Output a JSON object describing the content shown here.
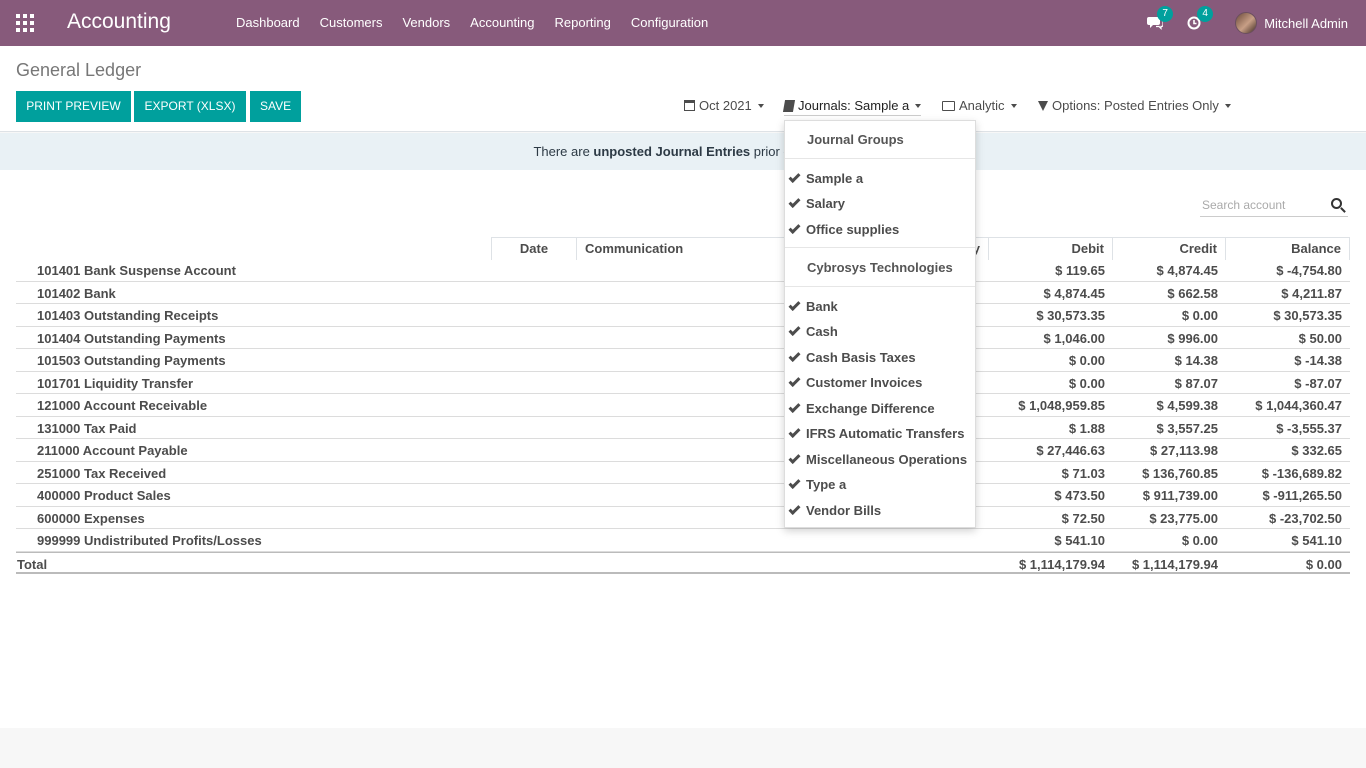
{
  "app": {
    "title": "Accounting"
  },
  "nav": {
    "menu": [
      "Dashboard",
      "Customers",
      "Vendors",
      "Accounting",
      "Reporting",
      "Configuration"
    ],
    "messages_count": "7",
    "activities_count": "4",
    "user": "Mitchell Admin"
  },
  "page": {
    "title": "General Ledger"
  },
  "buttons": {
    "print": "PRINT PREVIEW",
    "export": "EXPORT (XLSX)",
    "save": "SAVE"
  },
  "filters": {
    "period": "Oct 2021",
    "journals": "Journals: Sample a",
    "analytic": "Analytic",
    "options": "Options: Posted Entries Only"
  },
  "alert": {
    "prefix": "There are ",
    "strong": "unposted Journal Entries",
    "suffix": " prior or includ"
  },
  "search": {
    "placeholder": "Search account"
  },
  "table": {
    "headers": {
      "date": "Date",
      "communication": "Communication",
      "partner": "y",
      "debit": "Debit",
      "credit": "Credit",
      "balance": "Balance"
    },
    "rows": [
      {
        "name": "101401 Bank Suspense Account",
        "debit": "$ 119.65",
        "credit": "$ 4,874.45",
        "balance": "$ -4,754.80"
      },
      {
        "name": "101402 Bank",
        "debit": "$ 4,874.45",
        "credit": "$ 662.58",
        "balance": "$ 4,211.87"
      },
      {
        "name": "101403 Outstanding Receipts",
        "debit": "$ 30,573.35",
        "credit": "$ 0.00",
        "balance": "$ 30,573.35"
      },
      {
        "name": "101404 Outstanding Payments",
        "debit": "$ 1,046.00",
        "credit": "$ 996.00",
        "balance": "$ 50.00"
      },
      {
        "name": "101503 Outstanding Payments",
        "debit": "$ 0.00",
        "credit": "$ 14.38",
        "balance": "$ -14.38"
      },
      {
        "name": "101701 Liquidity Transfer",
        "debit": "$ 0.00",
        "credit": "$ 87.07",
        "balance": "$ -87.07"
      },
      {
        "name": "121000 Account Receivable",
        "debit": "$ 1,048,959.85",
        "credit": "$ 4,599.38",
        "balance": "$ 1,044,360.47"
      },
      {
        "name": "131000 Tax Paid",
        "debit": "$ 1.88",
        "credit": "$ 3,557.25",
        "balance": "$ -3,555.37"
      },
      {
        "name": "211000 Account Payable",
        "debit": "$ 27,446.63",
        "credit": "$ 27,113.98",
        "balance": "$ 332.65"
      },
      {
        "name": "251000 Tax Received",
        "debit": "$ 71.03",
        "credit": "$ 136,760.85",
        "balance": "$ -136,689.82"
      },
      {
        "name": "400000 Product Sales",
        "debit": "$ 473.50",
        "credit": "$ 911,739.00",
        "balance": "$ -911,265.50"
      },
      {
        "name": "600000 Expenses",
        "debit": "$ 72.50",
        "credit": "$ 23,775.00",
        "balance": "$ -23,702.50"
      },
      {
        "name": "999999 Undistributed Profits/Losses",
        "debit": "$ 541.10",
        "credit": "$ 0.00",
        "balance": "$ 541.10"
      }
    ],
    "total": {
      "name": "Total",
      "debit": "$ 1,114,179.94",
      "credit": "$ 1,114,179.94",
      "balance": "$ 0.00"
    }
  },
  "journal_dropdown": {
    "group_header": "Journal Groups",
    "groups": [
      "Sample a",
      "Salary",
      "Office supplies"
    ],
    "company_header": "Cybrosys Technologies",
    "journals": [
      "Bank",
      "Cash",
      "Cash Basis Taxes",
      "Customer Invoices",
      "Exchange Difference",
      "IFRS Automatic Transfers",
      "Miscellaneous Operations",
      "Type a",
      "Vendor Bills"
    ]
  }
}
